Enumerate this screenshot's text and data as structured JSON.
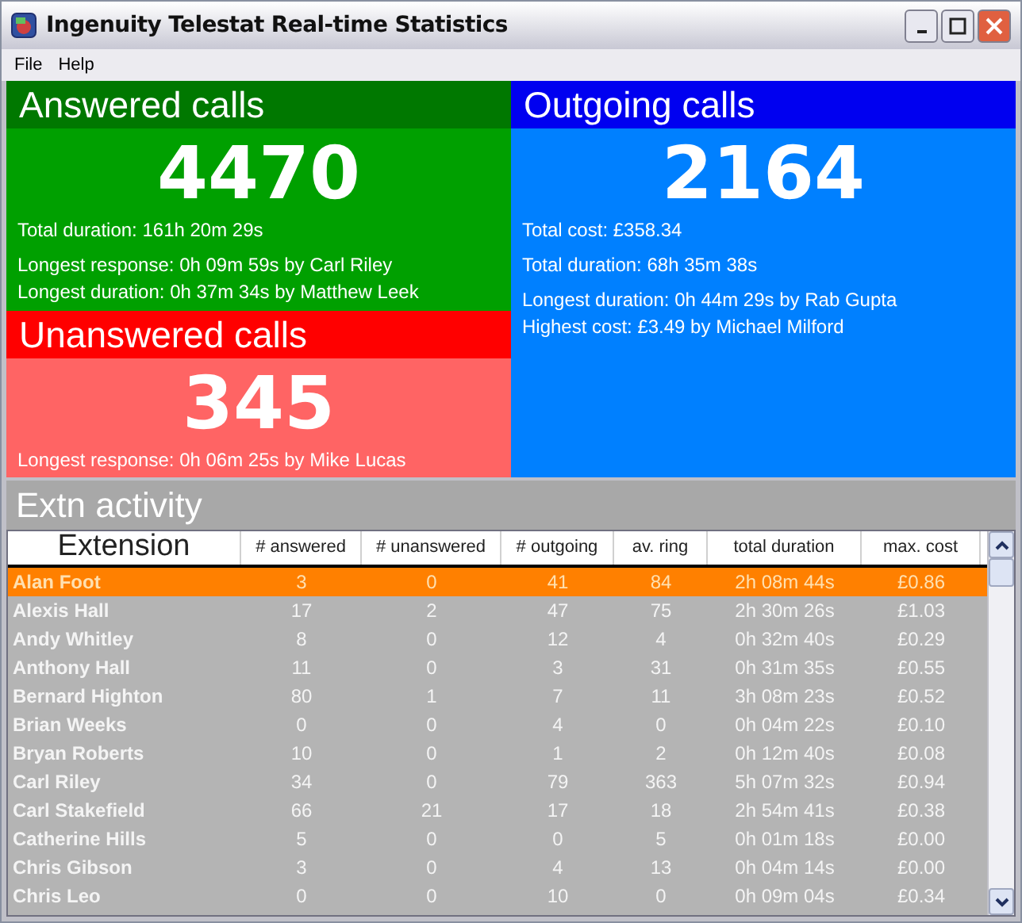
{
  "window": {
    "title": "Ingenuity Telestat Real-time Statistics"
  },
  "menu": [
    "File",
    "Help"
  ],
  "panels": [
    {
      "kind": "answered",
      "title": "Answered calls",
      "count": "4470",
      "detail_groups": [
        [
          "Total duration: 161h 20m 29s"
        ],
        [
          "Longest response: 0h 09m 59s by Carl Riley",
          "Longest duration: 0h 37m 34s by Matthew Leek"
        ]
      ]
    },
    {
      "kind": "unanswered",
      "title": "Unanswered calls",
      "count": "345",
      "detail_groups": [
        [
          "Longest response: 0h 06m 25s by Mike Lucas"
        ]
      ]
    },
    {
      "kind": "outgoing",
      "title": "Outgoing calls",
      "count": "2164",
      "detail_groups": [
        [
          "Total cost: £358.34"
        ],
        [
          "Total duration: 68h 35m 38s"
        ],
        [
          "Longest duration: 0h 44m 29s by Rab Gupta",
          "Highest cost: £3.49 by Michael Milford"
        ]
      ]
    }
  ],
  "activity": {
    "title": "Extn activity",
    "columns": [
      "Extension",
      "# answered",
      "# unanswered",
      "# outgoing",
      "av. ring",
      "total duration",
      "max. cost"
    ],
    "rows": [
      {
        "cells": [
          "Alan Foot",
          "3",
          "0",
          "41",
          "84",
          "2h 08m 44s",
          "£0.86"
        ],
        "selected": true
      },
      {
        "cells": [
          "Alexis Hall",
          "17",
          "2",
          "47",
          "75",
          "2h 30m 26s",
          "£1.03"
        ],
        "selected": false
      },
      {
        "cells": [
          "Andy Whitley",
          "8",
          "0",
          "12",
          "4",
          "0h 32m 40s",
          "£0.29"
        ],
        "selected": false
      },
      {
        "cells": [
          "Anthony Hall",
          "11",
          "0",
          "3",
          "31",
          "0h 31m 35s",
          "£0.55"
        ],
        "selected": false
      },
      {
        "cells": [
          "Bernard Highton",
          "80",
          "1",
          "7",
          "11",
          "3h 08m 23s",
          "£0.52"
        ],
        "selected": false
      },
      {
        "cells": [
          "Brian Weeks",
          "0",
          "0",
          "4",
          "0",
          "0h 04m 22s",
          "£0.10"
        ],
        "selected": false
      },
      {
        "cells": [
          "Bryan Roberts",
          "10",
          "0",
          "1",
          "2",
          "0h 12m 40s",
          "£0.08"
        ],
        "selected": false
      },
      {
        "cells": [
          "Carl Riley",
          "34",
          "0",
          "79",
          "363",
          "5h 07m 32s",
          "£0.94"
        ],
        "selected": false
      },
      {
        "cells": [
          "Carl Stakefield",
          "66",
          "21",
          "17",
          "18",
          "2h 54m 41s",
          "£0.38"
        ],
        "selected": false
      },
      {
        "cells": [
          "Catherine Hills",
          "5",
          "0",
          "0",
          "5",
          "0h 01m 18s",
          "£0.00"
        ],
        "selected": false
      },
      {
        "cells": [
          "Chris Gibson",
          "3",
          "0",
          "4",
          "13",
          "0h 04m 14s",
          "£0.00"
        ],
        "selected": false
      },
      {
        "cells": [
          "Chris Leo",
          "0",
          "0",
          "10",
          "0",
          "0h 09m 04s",
          "£0.34"
        ],
        "selected": false
      }
    ]
  }
}
